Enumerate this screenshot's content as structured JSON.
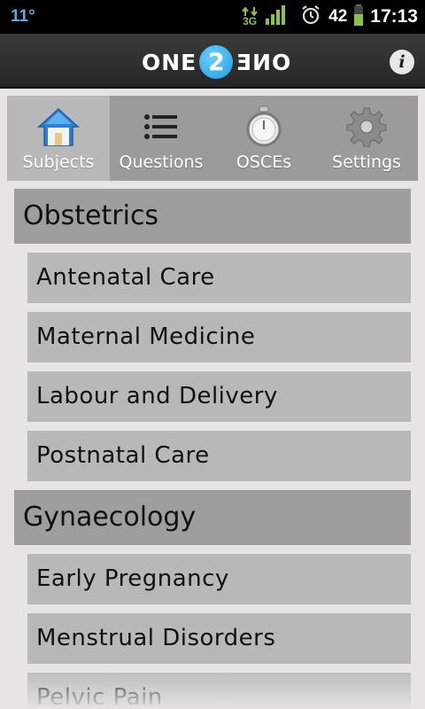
{
  "status_bar": {
    "temperature": "11°",
    "network_label": "3G",
    "battery_level": "42",
    "time": "17:13"
  },
  "app": {
    "logo_left": "ONE",
    "logo_number": "2",
    "logo_right": "ONE",
    "info_label": "i"
  },
  "tabs": [
    {
      "label": "Subjects",
      "icon": "home-icon",
      "active": true
    },
    {
      "label": "Questions",
      "icon": "list-icon",
      "active": false
    },
    {
      "label": "OSCEs",
      "icon": "stopwatch-icon",
      "active": false
    },
    {
      "label": "Settings",
      "icon": "gear-icon",
      "active": false
    }
  ],
  "sections": [
    {
      "title": "Obstetrics",
      "items": [
        "Antenatal Care",
        "Maternal Medicine",
        "Labour and Delivery",
        "Postnatal Care"
      ]
    },
    {
      "title": "Gynaecology",
      "items": [
        "Early Pregnancy",
        "Menstrual Disorders",
        "Pelvic Pain"
      ]
    }
  ],
  "colors": {
    "accent": "#1a9ee0",
    "signal": "#8bc34a",
    "section_header_bg": "#9e9e9e",
    "item_bg": "#b8b8b8"
  }
}
